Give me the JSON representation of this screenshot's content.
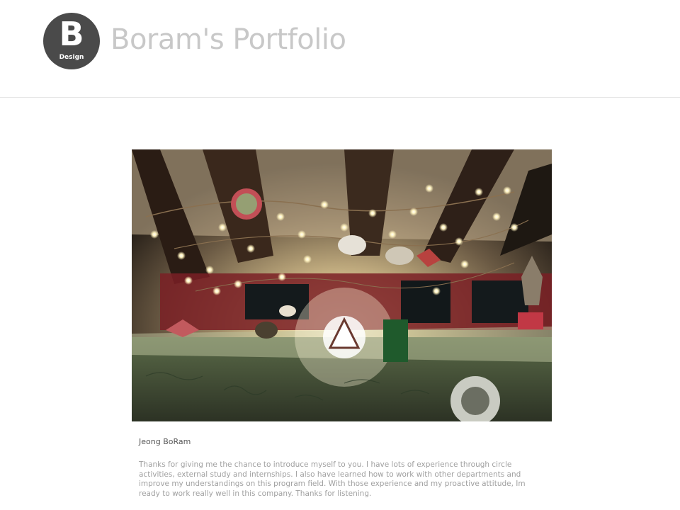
{
  "header": {
    "logo_letter": "B",
    "logo_sub": "Design",
    "title": "Boram's Portfolio"
  },
  "main": {
    "photo_icon": "photo-cafe-ceiling-lights",
    "author": "Jeong BoRam",
    "bio": "Thanks for giving me the chance to introduce myself to you. I have lots of experience through circle activities, external study and internships. I also have learned how to work with other departments and improve my understandings on this program field. With those experience and my proactive attitude, Im ready to work really well in this company. Thanks for listening."
  },
  "colors": {
    "logo_bg": "#4a4a4a",
    "title": "#c8c8c8",
    "author": "#555555",
    "bio": "#a0a0a0"
  }
}
